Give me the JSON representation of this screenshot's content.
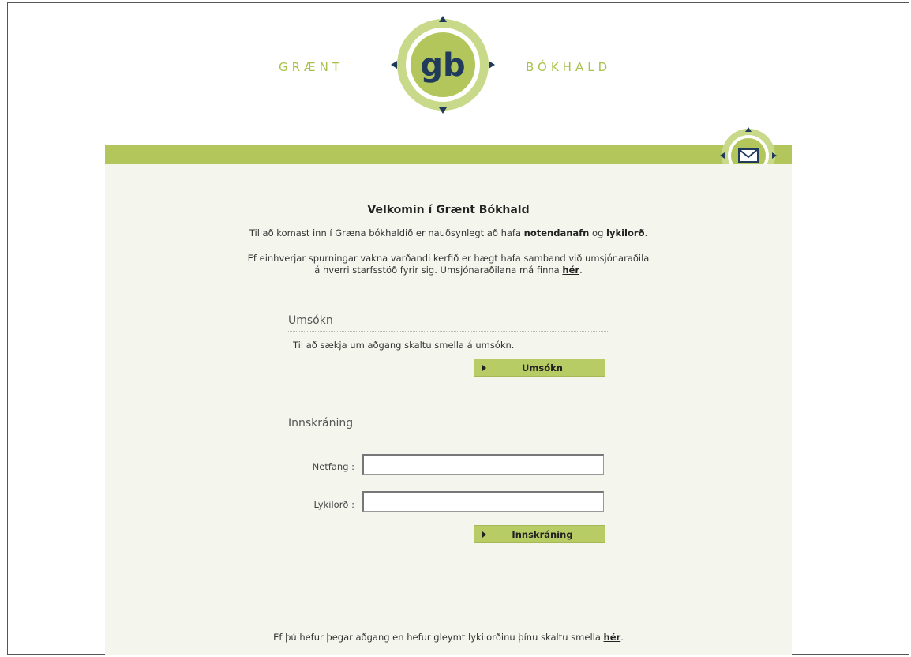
{
  "header": {
    "brand_left": "GRÆNT",
    "brand_right": "BÓKHALD",
    "logo_text": "gb"
  },
  "colors": {
    "accent_green": "#b3c65c",
    "panel_bg": "#f4f6ee",
    "logo_dark": "#1f3a5a"
  },
  "welcome": {
    "title": "Velkomin í Grænt Bókhald",
    "intro_before": "Til að komast inn í Græna bókhaldið er nauðsynlegt að hafa ",
    "intro_username": "notendanafn",
    "intro_mid": " og ",
    "intro_password": "lykilorð",
    "intro_end": ".",
    "contact_line1": "Ef einhverjar spurningar vakna varðandi kerfið er hægt hafa samband við umsjónaraðila",
    "contact_line2_before": "á hverri starfsstöð fyrir sig. Umsjónaraðilana má finna ",
    "contact_link": "hér",
    "contact_end": "."
  },
  "application": {
    "heading": "Umsókn",
    "text": "Til að sækja um aðgang skaltu smella á umsókn.",
    "button_label": "Umsókn"
  },
  "login": {
    "heading": "Innskráning",
    "email_label": "Netfang :",
    "email_value": "",
    "password_label": "Lykilorð :",
    "password_value": "",
    "button_label": "Innskráning"
  },
  "footer": {
    "forgot_before": "Ef þú hefur þegar aðgang en hefur gleymt lykilorðinu þínu skaltu smella ",
    "forgot_link": "hér",
    "forgot_end": "."
  },
  "icons": {
    "logo": "gb-logo-icon",
    "mail": "envelope-icon",
    "button_arrow": "arrow-right-icon"
  }
}
